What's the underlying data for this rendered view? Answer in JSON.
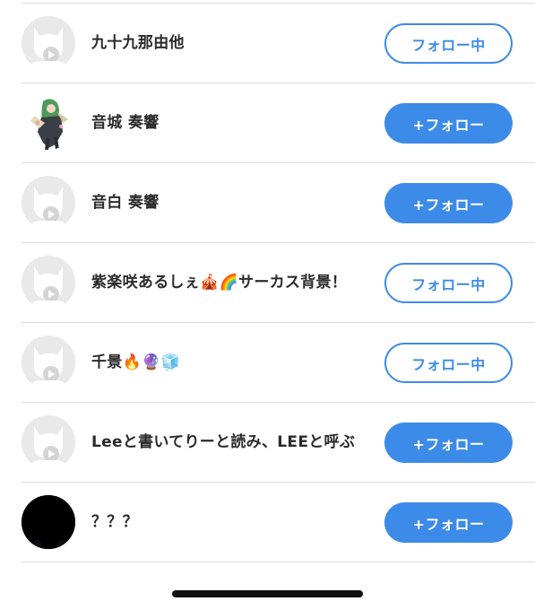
{
  "colors": {
    "accent": "#3d8be8",
    "divider": "#dcdcdc",
    "placeholder_avatar": "#e9e9e9"
  },
  "users": [
    {
      "name": "九十九那由他",
      "button": "フォロー中",
      "state": "following",
      "avatar": "default-cat-avatar"
    },
    {
      "name": "音城 奏響",
      "button": "+フォロー",
      "state": "follow",
      "avatar": "anime-character-avatar"
    },
    {
      "name": "音白 奏響",
      "button": "+フォロー",
      "state": "follow",
      "avatar": "default-cat-avatar"
    },
    {
      "name": "紫楽咲あるしぇ🎪🌈サーカス背景！",
      "button": "フォロー中",
      "state": "following",
      "avatar": "default-cat-avatar"
    },
    {
      "name": "千景🔥🔮🧊",
      "button": "フォロー中",
      "state": "following",
      "avatar": "default-cat-avatar"
    },
    {
      "name": "Leeと書いてりーと読み、LEEと呼ぶ",
      "button": "+フォロー",
      "state": "follow",
      "avatar": "default-cat-avatar"
    },
    {
      "name": "？？？",
      "button": "+フォロー",
      "state": "follow",
      "avatar": "black-avatar"
    }
  ]
}
